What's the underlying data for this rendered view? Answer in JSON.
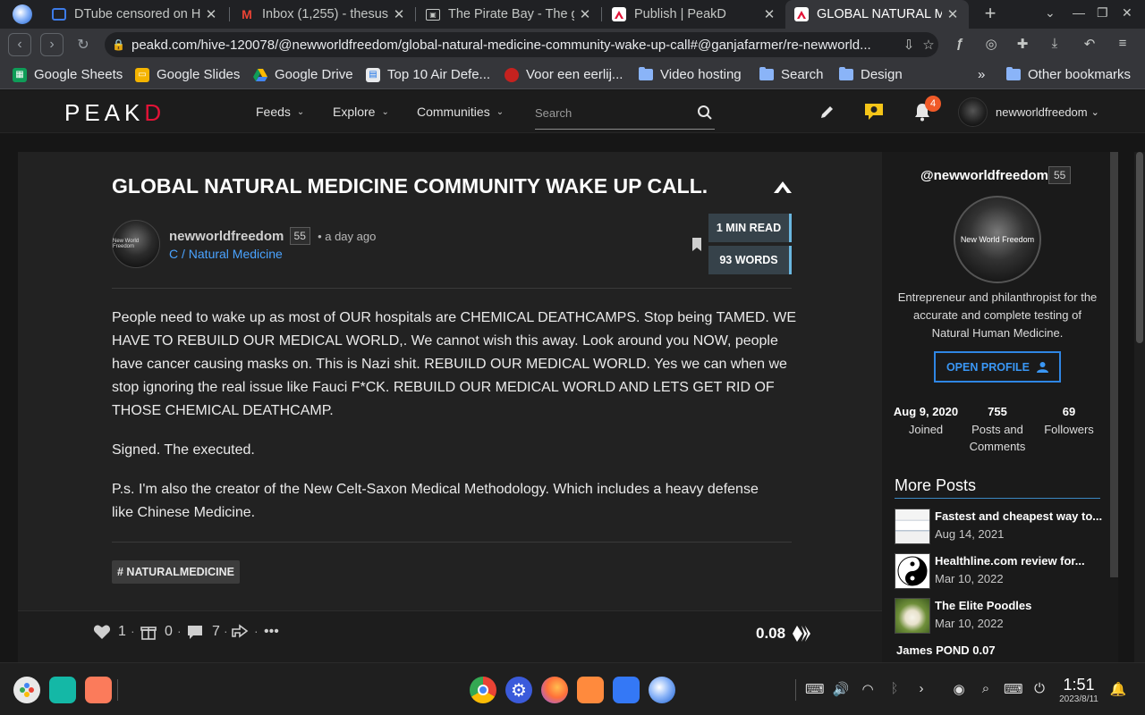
{
  "browser": {
    "tabs": [
      {
        "title": "DTube censored on H",
        "icon": "dtube-icon"
      },
      {
        "title": "Inbox (1,255) - thesus",
        "icon": "gmail-icon"
      },
      {
        "title": "The Pirate Bay - The g",
        "icon": "piratebay-icon"
      },
      {
        "title": "Publish | PeakD",
        "icon": "peakd-icon"
      },
      {
        "title": "GLOBAL NATURAL ME",
        "icon": "peakd-icon",
        "active": true
      }
    ],
    "url": "peakd.com/hive-120078/@newworldfreedom/global-natural-medicine-community-wake-up-call#@ganjafarmer/re-newworld...",
    "bookmarks": [
      {
        "label": "Google Sheets",
        "icon": "sheets-icon"
      },
      {
        "label": "Google Slides",
        "icon": "slides-icon"
      },
      {
        "label": "Google Drive",
        "icon": "drive-icon"
      },
      {
        "label": "Top 10 Air Defe...",
        "icon": "page-icon"
      },
      {
        "label": "Voor een eerlij...",
        "icon": "red-circle-icon"
      },
      {
        "label": "Video hosting",
        "icon": "folder-icon"
      },
      {
        "label": "Search",
        "icon": "folder-icon"
      },
      {
        "label": "Design",
        "icon": "folder-icon"
      }
    ],
    "overflow_label": "»",
    "other_bookmarks": "Other bookmarks"
  },
  "header": {
    "logo_main": "PEAK",
    "logo_accent": "D",
    "menu": {
      "feeds": "Feeds",
      "explore": "Explore",
      "communities": "Communities"
    },
    "search_placeholder": "Search",
    "notification_count": "4",
    "username": "newworldfreedom"
  },
  "post": {
    "title": "GLOBAL NATURAL MEDICINE COMMUNITY WAKE UP CALL.",
    "author": "newworldfreedom",
    "author_rep": "55",
    "time": "• a day ago",
    "community": "C / Natural Medicine",
    "read_time": "1 MIN READ",
    "word_count": "93 WORDS",
    "avatar_text": "New World Freedom",
    "paragraphs": [
      "People need to wake up as most of OUR hospitals are CHEMICAL DEATHCAMPS. Stop being TAMED. WE HAVE TO REBUILD OUR MEDICAL WORLD,. We cannot wish this away. Look around you NOW, people have cancer causing masks on. This is Nazi shit. REBUILD OUR MEDICAL WORLD. Yes we can when we stop ignoring the real issue like Fauci F*CK. REBUILD OUR MEDICAL WORLD AND LETS GET RID OF THOSE CHEMICAL DEATHCAMP.",
      "Signed. The executed.",
      "P.s. I'm also the creator of the New Celt-Saxon Medical Methodology. Which includes a heavy defense like Chinese Medicine."
    ],
    "tag": "# NATURALMEDICINE",
    "votes": "1",
    "reblogs": "0",
    "comments": "7",
    "payout": "0.08"
  },
  "sidebar": {
    "handle": "@newworldfreedom",
    "rep": "55",
    "avatar_text": "New World Freedom",
    "bio": "Entrepreneur and philanthropist for the accurate and complete testing of Natural Human Medicine.",
    "open_profile": "OPEN PROFILE",
    "joined_value": "Aug 9, 2020",
    "joined_label": "Joined",
    "posts_value": "755",
    "posts_label": "Posts and Comments",
    "followers_value": "69",
    "followers_label": "Followers",
    "more_posts_title": "More Posts",
    "more_posts": [
      {
        "title": "Fastest and cheapest way to...",
        "date": "Aug 14, 2021"
      },
      {
        "title": "Healthline.com review for...",
        "date": "Mar 10, 2022"
      },
      {
        "title": "The Elite Poodles",
        "date": "Mar 10, 2022"
      }
    ],
    "cut_item": "James POND 0.07"
  },
  "taskbar": {
    "time": "1:51",
    "date": "2023/8/11"
  }
}
